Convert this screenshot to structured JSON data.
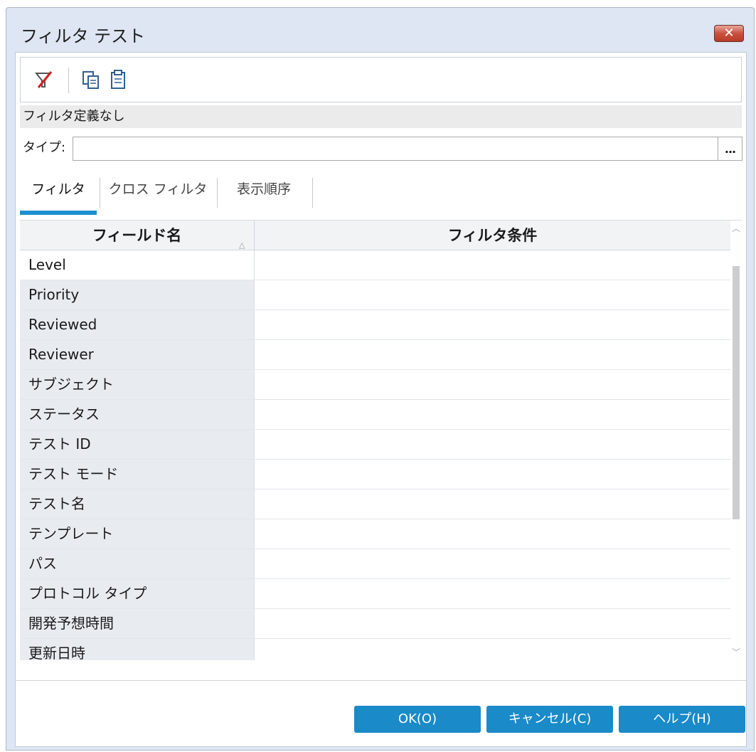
{
  "window": {
    "title": "フィルタ テスト",
    "close_glyph": "✕"
  },
  "toolbar": {
    "buttons": [
      {
        "name": "clear-filter",
        "icon": "filter-clear-icon"
      },
      {
        "name": "copy",
        "icon": "copy-icon"
      },
      {
        "name": "paste",
        "icon": "paste-icon"
      }
    ]
  },
  "status": {
    "text": "フィルタ定義なし"
  },
  "type_field": {
    "label": "タイプ:",
    "value": "",
    "browse_label": "..."
  },
  "tabs": [
    {
      "label": "フィルタ",
      "active": true
    },
    {
      "label": "クロス フィルタ",
      "active": false
    },
    {
      "label": "表示順序",
      "active": false
    }
  ],
  "grid": {
    "columns": [
      "フィールド名",
      "フィルタ条件"
    ],
    "sort_glyph": "△",
    "rows": [
      {
        "field": "Level",
        "condition": ""
      },
      {
        "field": "Priority",
        "condition": ""
      },
      {
        "field": "Reviewed",
        "condition": ""
      },
      {
        "field": "Reviewer",
        "condition": ""
      },
      {
        "field": "サブジェクト",
        "condition": ""
      },
      {
        "field": "ステータス",
        "condition": ""
      },
      {
        "field": "テスト ID",
        "condition": ""
      },
      {
        "field": "テスト モード",
        "condition": ""
      },
      {
        "field": "テスト名",
        "condition": ""
      },
      {
        "field": "テンプレート",
        "condition": ""
      },
      {
        "field": "パス",
        "condition": ""
      },
      {
        "field": "プロトコル タイプ",
        "condition": ""
      },
      {
        "field": "開発予想時間",
        "condition": ""
      },
      {
        "field": "更新日時",
        "condition": ""
      }
    ]
  },
  "buttons": {
    "ok": "OK(O)",
    "cancel": "キャンセル(C)",
    "help": "ヘルプ(H)"
  },
  "colors": {
    "accent": "#1a8ac8",
    "tab_active": "#1e90cf",
    "close": "#c95140"
  }
}
